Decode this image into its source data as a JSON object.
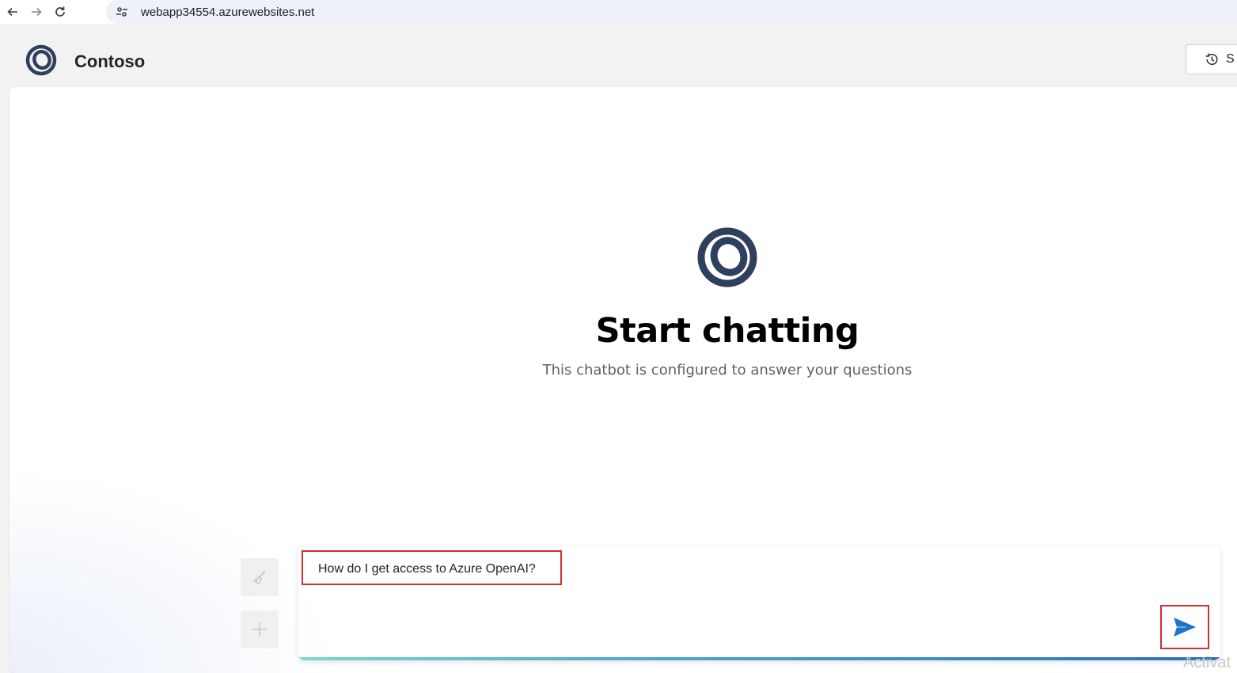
{
  "browser": {
    "url": "webapp34554.azurewebsites.net",
    "back_icon": "arrow-left-icon",
    "forward_icon": "arrow-right-icon",
    "reload_icon": "reload-icon",
    "site_info_icon": "tune-icon"
  },
  "header": {
    "title": "Contoso",
    "history_button_label": "S",
    "history_icon": "history-icon"
  },
  "empty_state": {
    "title": "Start chatting",
    "subtitle": "This chatbot is configured to answer your questions"
  },
  "actions": {
    "clear_icon": "broom-icon",
    "new_chat_icon": "plus-icon"
  },
  "input": {
    "value": "How do I get access to Azure OpenAI?",
    "send_icon": "send-icon"
  },
  "watermark": {
    "text": "Activat"
  },
  "colors": {
    "brand_dark": "#2f3f5e",
    "send_blue": "#1f73c8",
    "highlight_red": "#d32f2f"
  }
}
